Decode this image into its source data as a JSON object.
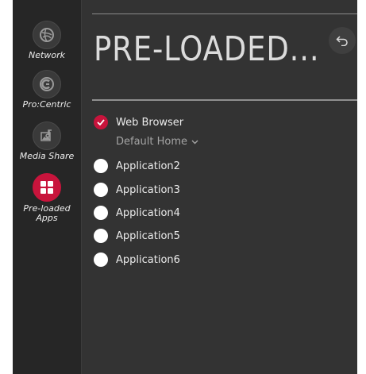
{
  "sidebar": {
    "items": [
      {
        "label": "Network",
        "icon": "globe-icon"
      },
      {
        "label": "Pro:Centric",
        "icon": "procentric-icon"
      },
      {
        "label": "Media Share",
        "icon": "media-share-icon"
      },
      {
        "label": "Pre-loaded Apps",
        "icon": "apps-grid-icon",
        "active": true
      }
    ]
  },
  "header": {
    "title": "PRE-LOADED...",
    "back_icon": "back-arrow-icon"
  },
  "apps": {
    "items": [
      {
        "label": "Web Browser",
        "checked": true
      },
      {
        "label": "Application2",
        "checked": false
      },
      {
        "label": "Application3",
        "checked": false
      },
      {
        "label": "Application4",
        "checked": false
      },
      {
        "label": "Application5",
        "checked": false
      },
      {
        "label": "Application6",
        "checked": false
      }
    ],
    "default_home_label": "Default Home"
  },
  "colors": {
    "accent": "#c8143c",
    "panel": "#333333",
    "sidebar": "#262626"
  }
}
